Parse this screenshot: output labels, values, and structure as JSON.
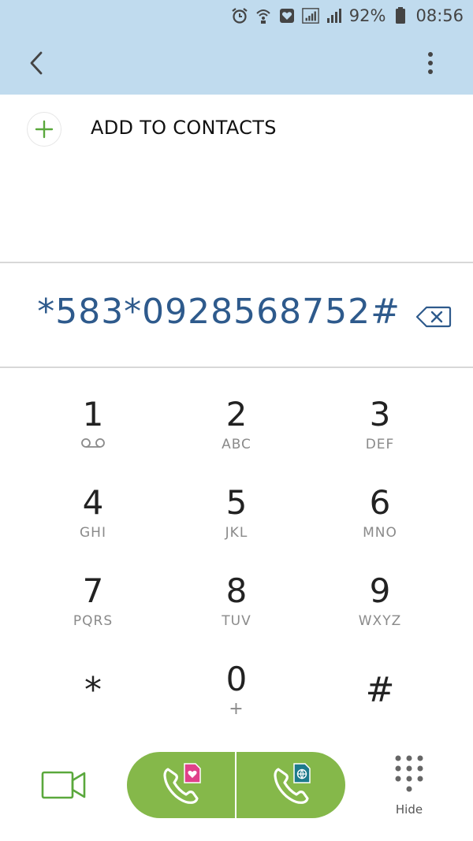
{
  "status_bar": {
    "battery_percent": "92%",
    "time": "08:56",
    "icons": [
      "alarm-icon",
      "wifi-calling-icon",
      "heart-sim-icon",
      "signal-sim1-icon",
      "signal-sim2-icon",
      "battery-icon"
    ]
  },
  "header": {
    "back_icon": "chevron-left-icon",
    "more_icon": "more-vertical-icon",
    "background": "#c0dbee"
  },
  "add_contact": {
    "label": "ADD TO CONTACTS",
    "icon": "plus-icon",
    "accent": "#5aa83c"
  },
  "dial_number": "*583*0928568752#",
  "keys": [
    {
      "digit": "1",
      "letters": ""
    },
    {
      "digit": "2",
      "letters": "ABC"
    },
    {
      "digit": "3",
      "letters": "DEF"
    },
    {
      "digit": "4",
      "letters": "GHI"
    },
    {
      "digit": "5",
      "letters": "JKL"
    },
    {
      "digit": "6",
      "letters": "MNO"
    },
    {
      "digit": "7",
      "letters": "PQRS"
    },
    {
      "digit": "8",
      "letters": "TUV"
    },
    {
      "digit": "9",
      "letters": "WXYZ"
    },
    {
      "digit": "*",
      "letters": ""
    },
    {
      "digit": "0",
      "letters": "+"
    },
    {
      "digit": "#",
      "letters": ""
    }
  ],
  "bottom": {
    "hide_label": "Hide",
    "call_color": "#85b84a",
    "video_icon": "video-call-icon",
    "sim1_icon": "sim-heart-icon",
    "sim2_icon": "sim-globe-icon"
  }
}
